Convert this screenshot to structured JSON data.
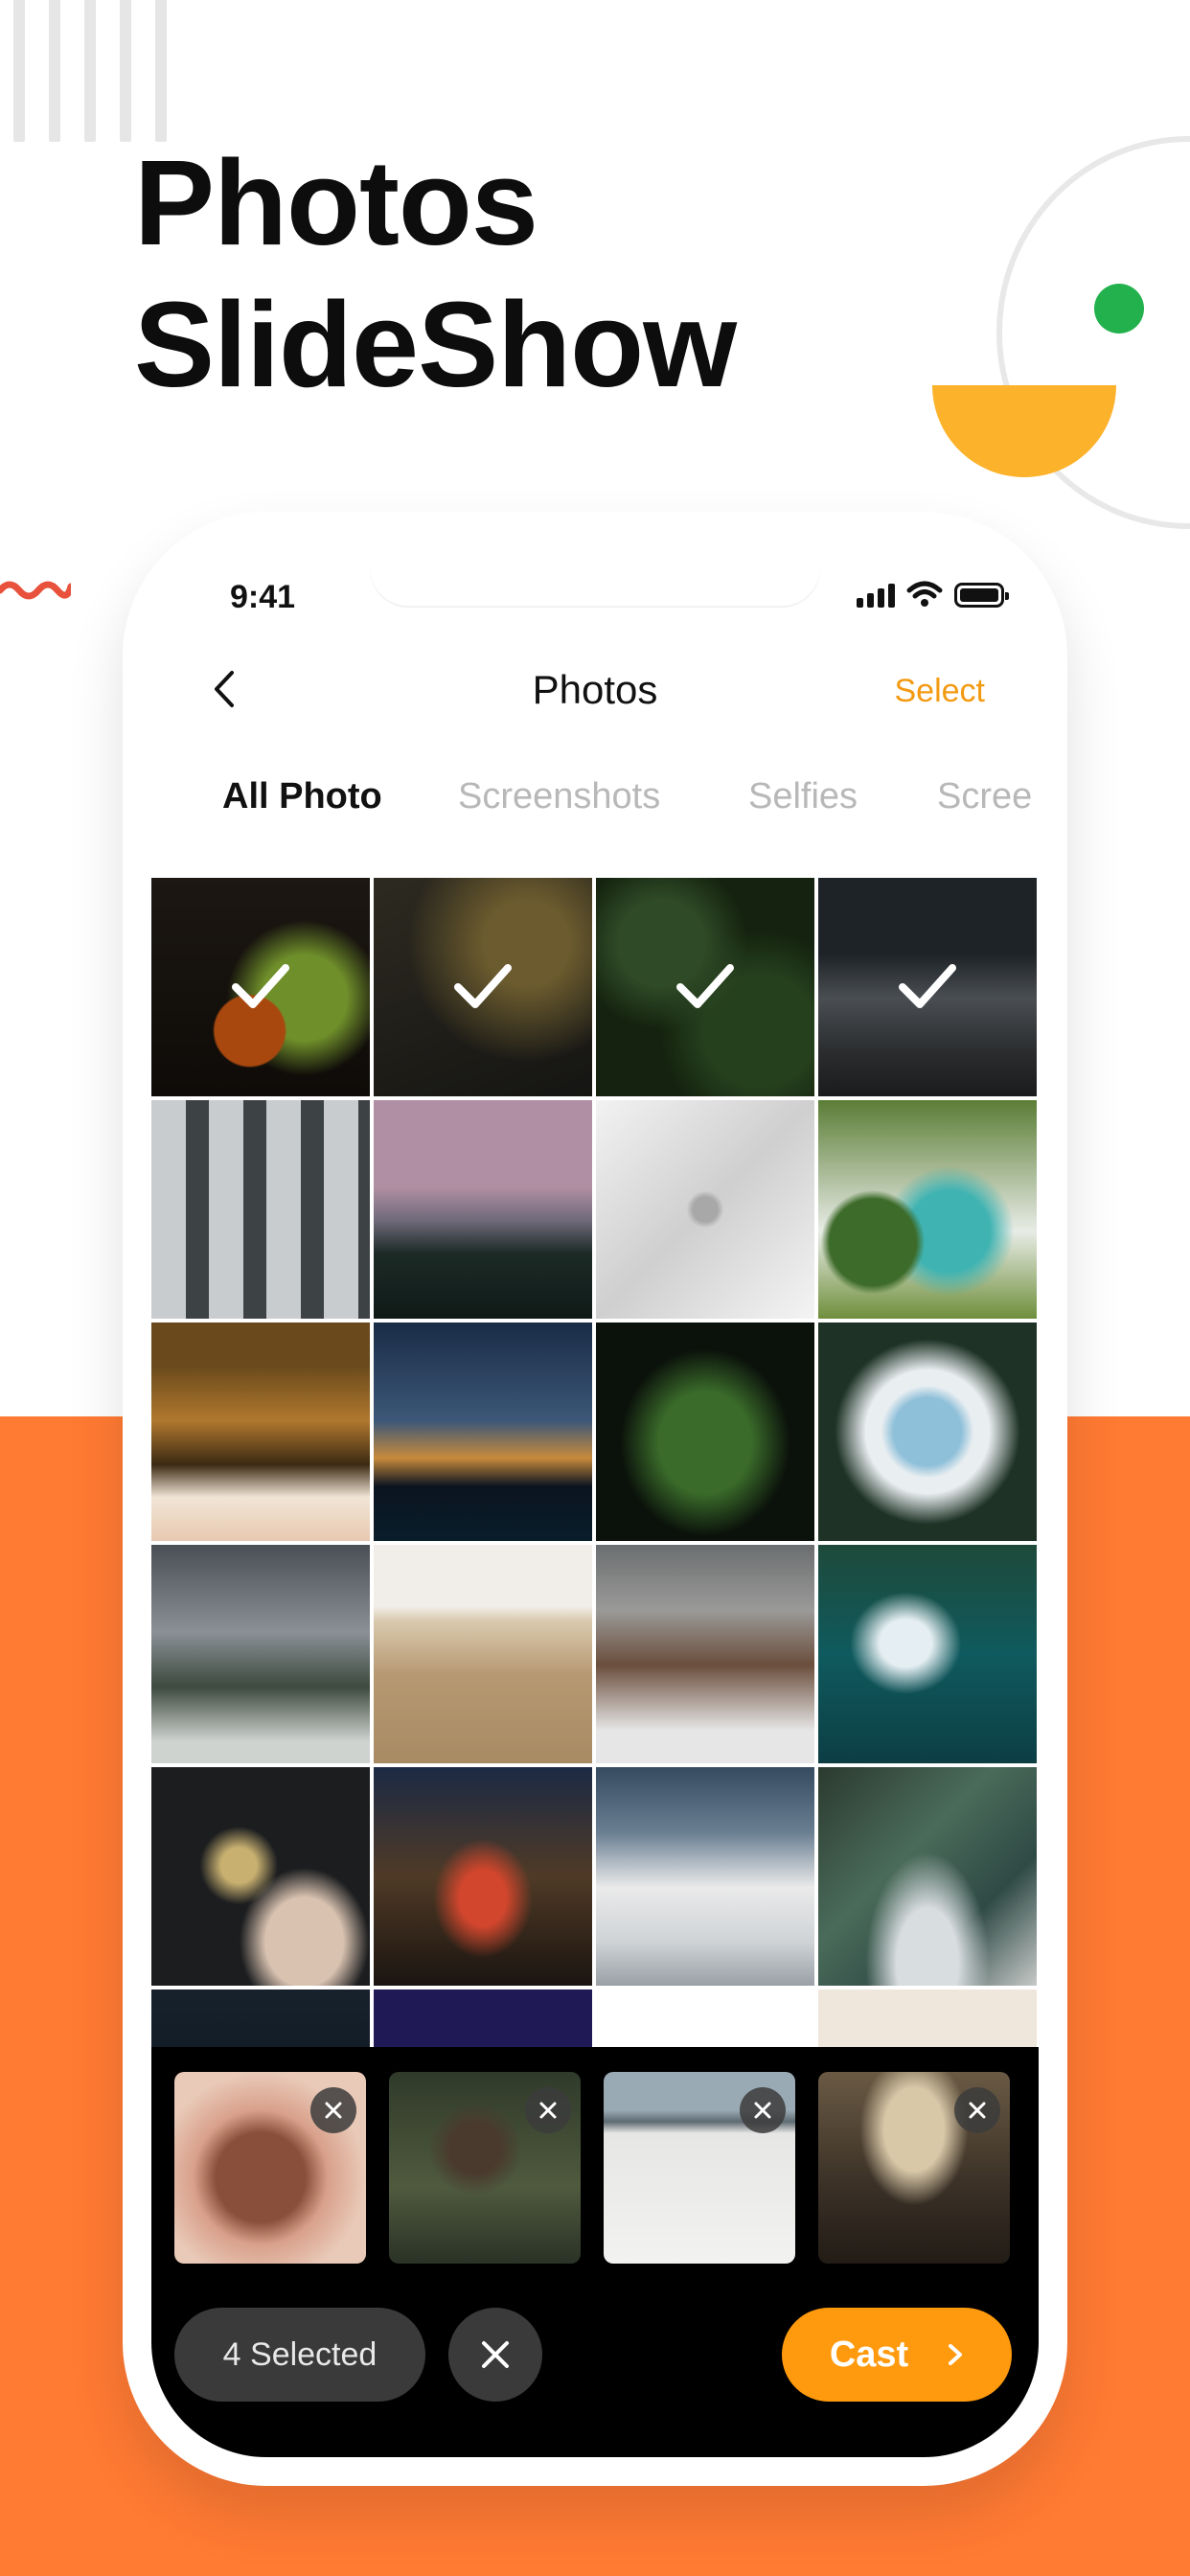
{
  "headline": {
    "line1": "Photos",
    "line2": "SlideShow"
  },
  "status_bar": {
    "time": "9:41",
    "icons": [
      "signal-icon",
      "wifi-icon",
      "battery-icon"
    ]
  },
  "nav": {
    "title": "Photos",
    "select_label": "Select",
    "back_icon": "chevron-left-icon"
  },
  "tabs": [
    {
      "label": "All Photo",
      "active": true
    },
    {
      "label": "Screenshots",
      "active": false
    },
    {
      "label": "Selfies",
      "active": false
    },
    {
      "label": "Scree",
      "active": false
    }
  ],
  "grid": {
    "rows": [
      [
        {
          "desc": "jack-o-lantern with smoke",
          "selected": true
        },
        {
          "desc": "dark winding road",
          "selected": true
        },
        {
          "desc": "dark green leaves",
          "selected": true
        },
        {
          "desc": "dark snowy mountains",
          "selected": true
        }
      ],
      [
        {
          "desc": "grey building facade",
          "selected": false
        },
        {
          "desc": "pink sky moonrise over pines",
          "selected": false
        },
        {
          "desc": "snowy winding road aerial",
          "selected": false
        },
        {
          "desc": "river lagoon aerial",
          "selected": false
        }
      ],
      [
        {
          "desc": "palm forest aerial beach",
          "selected": false
        },
        {
          "desc": "milky way over palms",
          "selected": false
        },
        {
          "desc": "fern leaf dark",
          "selected": false
        },
        {
          "desc": "frozen lake aerial",
          "selected": false
        }
      ],
      [
        {
          "desc": "misty mountain lake",
          "selected": false
        },
        {
          "desc": "sand and surf aerial",
          "selected": false
        },
        {
          "desc": "rocky snowy mountains",
          "selected": false
        },
        {
          "desc": "ocean waves aerial",
          "selected": false
        }
      ],
      [
        {
          "desc": "bird landing on hand",
          "selected": false
        },
        {
          "desc": "city light trails night",
          "selected": false
        },
        {
          "desc": "snowy mountain range",
          "selected": false
        },
        {
          "desc": "braided river aerial",
          "selected": false
        }
      ],
      [
        {
          "desc": "city at night",
          "selected": false
        },
        {
          "desc": "purple glowing spheres",
          "selected": false
        },
        {
          "desc": "snowy landscape",
          "selected": false
        },
        {
          "desc": "latte art cup",
          "selected": false
        }
      ]
    ]
  },
  "selection_tray": {
    "thumbnails": [
      {
        "desc": "reflection in glass ball"
      },
      {
        "desc": "dried sunflower"
      },
      {
        "desc": "salt flat with mountains"
      },
      {
        "desc": "arcade gallery with people"
      }
    ],
    "selected_count_label": "4 Selected",
    "cast_label": "Cast"
  },
  "colors": {
    "accent_orange": "#FF7A33",
    "select_text": "#F39A11",
    "cast_button": "#FF9A0E",
    "deco_green": "#22B14C",
    "deco_yellow": "#FDB22B",
    "deco_squiggle": "#E8513B"
  }
}
